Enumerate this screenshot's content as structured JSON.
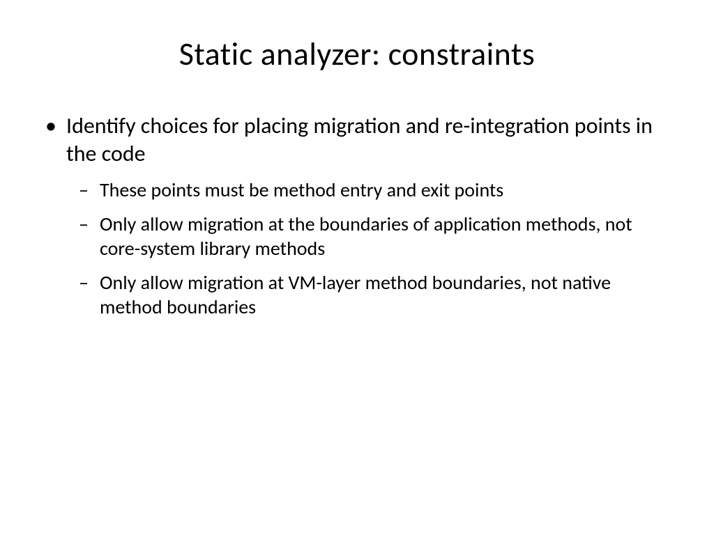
{
  "slide": {
    "title": "Static analyzer: constraints",
    "bullets": [
      {
        "text": "Identify choices for placing migration and re-integration points in the code",
        "subitems": [
          "These points must be method entry and exit points",
          "Only allow migration at the boundaries of application methods, not core-system library methods",
          "Only allow migration at VM-layer method boundaries, not native method boundaries"
        ]
      }
    ]
  }
}
